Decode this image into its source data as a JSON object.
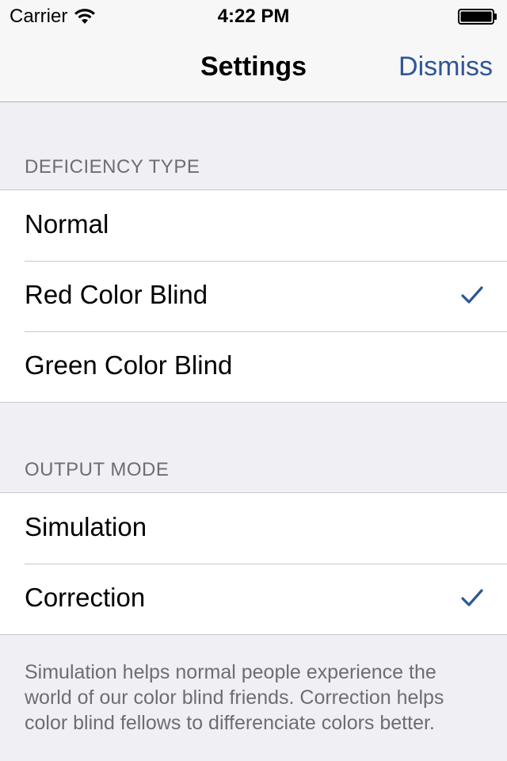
{
  "status_bar": {
    "carrier": "Carrier",
    "time": "4:22 PM",
    "icons": [
      "wifi-icon",
      "battery-icon"
    ]
  },
  "nav": {
    "title": "Settings",
    "dismiss_label": "Dismiss"
  },
  "sections": [
    {
      "header": "DEFICIENCY TYPE",
      "rows": [
        {
          "label": "Normal",
          "checked": false
        },
        {
          "label": "Red Color Blind",
          "checked": true
        },
        {
          "label": "Green Color Blind",
          "checked": false
        }
      ]
    },
    {
      "header": "OUTPUT MODE",
      "rows": [
        {
          "label": "Simulation",
          "checked": false
        },
        {
          "label": "Correction",
          "checked": true
        }
      ],
      "footer": "Simulation helps normal people experience the world of our color blind friends. Correction helps color blind fellows to differenciate colors better."
    }
  ],
  "colors": {
    "accent": "#2f5597",
    "background": "#efeff4",
    "secondary_text": "#6d6d72"
  }
}
